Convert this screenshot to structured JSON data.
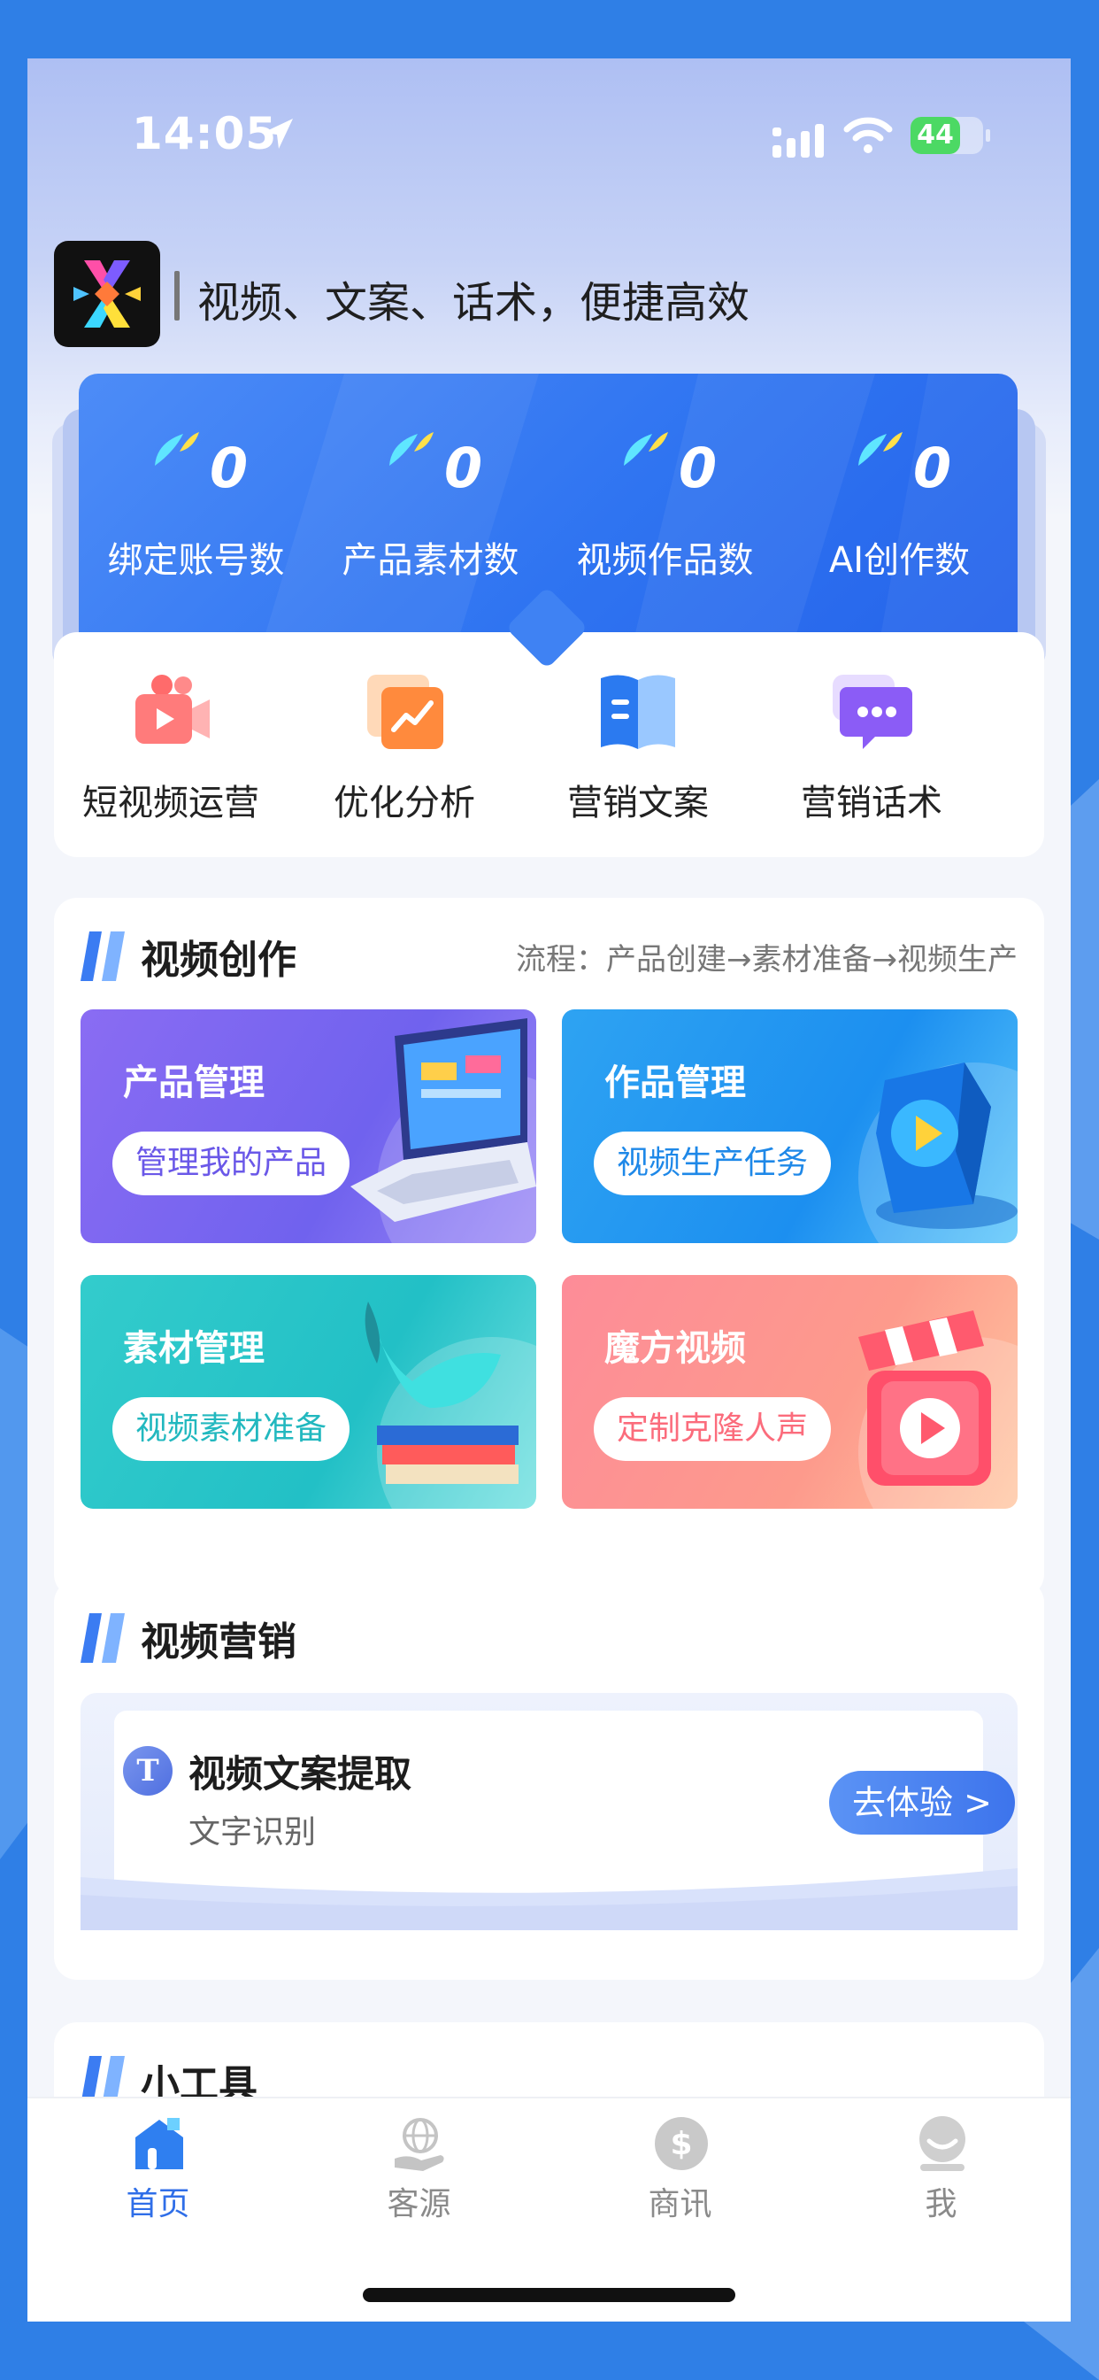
{
  "status": {
    "time": "14:05",
    "battery": "44"
  },
  "header": {
    "slogan": "视频、文案、话术，便捷高效"
  },
  "stats": [
    {
      "value": "0",
      "label": "绑定账号数"
    },
    {
      "value": "0",
      "label": "产品素材数"
    },
    {
      "value": "0",
      "label": "视频作品数"
    },
    {
      "value": "0",
      "label": "AI创作数"
    }
  ],
  "quick": [
    {
      "label": "短视频运营",
      "icon": "video-camera-icon"
    },
    {
      "label": "优化分析",
      "icon": "chart-analysis-icon"
    },
    {
      "label": "营销文案",
      "icon": "book-icon"
    },
    {
      "label": "营销话术",
      "icon": "chat-bubble-icon"
    }
  ],
  "creation": {
    "title": "视频创作",
    "flow": "流程：产品创建→素材准备→视频生产",
    "tiles": [
      {
        "title": "产品管理",
        "button": "管理我的产品",
        "color": "#7b6cf0"
      },
      {
        "title": "作品管理",
        "button": "视频生产任务",
        "color": "#3aa8f3"
      },
      {
        "title": "素材管理",
        "button": "视频素材准备",
        "color": "#3cc9c9"
      },
      {
        "title": "魔方视频",
        "button": "定制克隆人声",
        "color": "#fb8a8e"
      }
    ]
  },
  "marketing": {
    "title": "视频营销",
    "item_icon": "T",
    "item_title": "视频文案提取",
    "item_sub": "文字识别",
    "button": "去体验 >"
  },
  "tools": {
    "title": "小工具"
  },
  "tabs": [
    {
      "label": "首页",
      "active": true,
      "icon": "home-icon"
    },
    {
      "label": "客源",
      "active": false,
      "icon": "globe-hand-icon"
    },
    {
      "label": "商讯",
      "active": false,
      "icon": "dollar-coin-icon"
    },
    {
      "label": "我",
      "active": false,
      "icon": "profile-icon"
    }
  ],
  "colors": {
    "accent": "#2f6ee8",
    "background": "#2f7fe6"
  }
}
